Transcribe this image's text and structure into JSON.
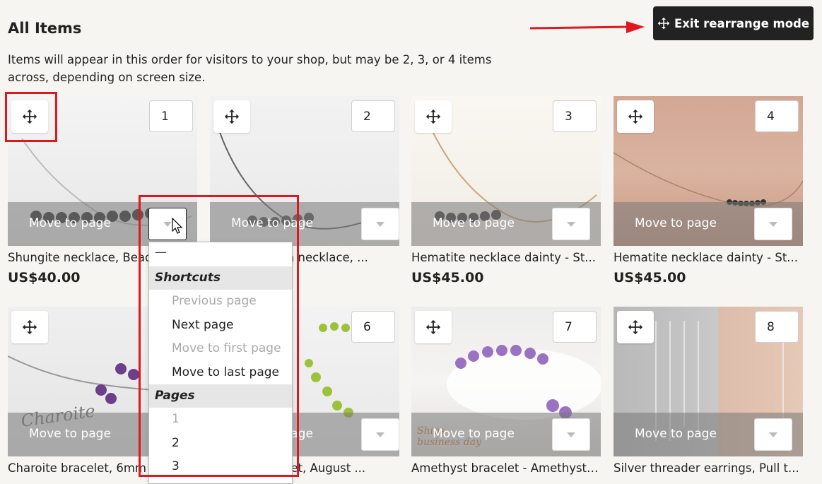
{
  "page": {
    "title": "All Items",
    "description": "Items will appear in this order for visitors to your shop, but may be 2, 3, or 4 items across, depending on screen size.",
    "exit_button_label": "Exit rearrange mode",
    "move_to_page_label": "Move to page"
  },
  "items": [
    {
      "position": "1",
      "title": "Shungite necklace, Bead",
      "price": "US$40.00"
    },
    {
      "position": "2",
      "title": "Black obsidian necklace, ...",
      "price": ""
    },
    {
      "position": "3",
      "title": "Hematite necklace dainty - St...",
      "price": "US$45.00"
    },
    {
      "position": "4",
      "title": "Hematite necklace dainty - St...",
      "price": "US$45.00"
    },
    {
      "position": "5",
      "title": "Charoite bracelet, 6mm",
      "price": ""
    },
    {
      "position": "6",
      "title": "Peridot bracelet, August ...",
      "price": ""
    },
    {
      "position": "7",
      "title": "Amethyst bracelet - Amethyst ...",
      "price": ""
    },
    {
      "position": "8",
      "title": "Silver threader earrings, Pull t...",
      "price": ""
    }
  ],
  "dropdown": {
    "placeholder": "—",
    "shortcuts_heading": "Shortcuts",
    "shortcuts": [
      {
        "label": "Previous page",
        "enabled": false
      },
      {
        "label": "Next page",
        "enabled": true
      },
      {
        "label": "Move to first page",
        "enabled": false
      },
      {
        "label": "Move to last page",
        "enabled": true
      }
    ],
    "pages_heading": "Pages",
    "pages": [
      {
        "label": "1",
        "enabled": false
      },
      {
        "label": "2",
        "enabled": true
      },
      {
        "label": "3",
        "enabled": true
      }
    ]
  },
  "image_overlays": {
    "charoite_label": "Charoite",
    "ships_label": "Ships\nbusiness day"
  },
  "colors": {
    "background": "#f6f5f2",
    "button_dark": "#222222",
    "highlight": "#e0171c"
  }
}
